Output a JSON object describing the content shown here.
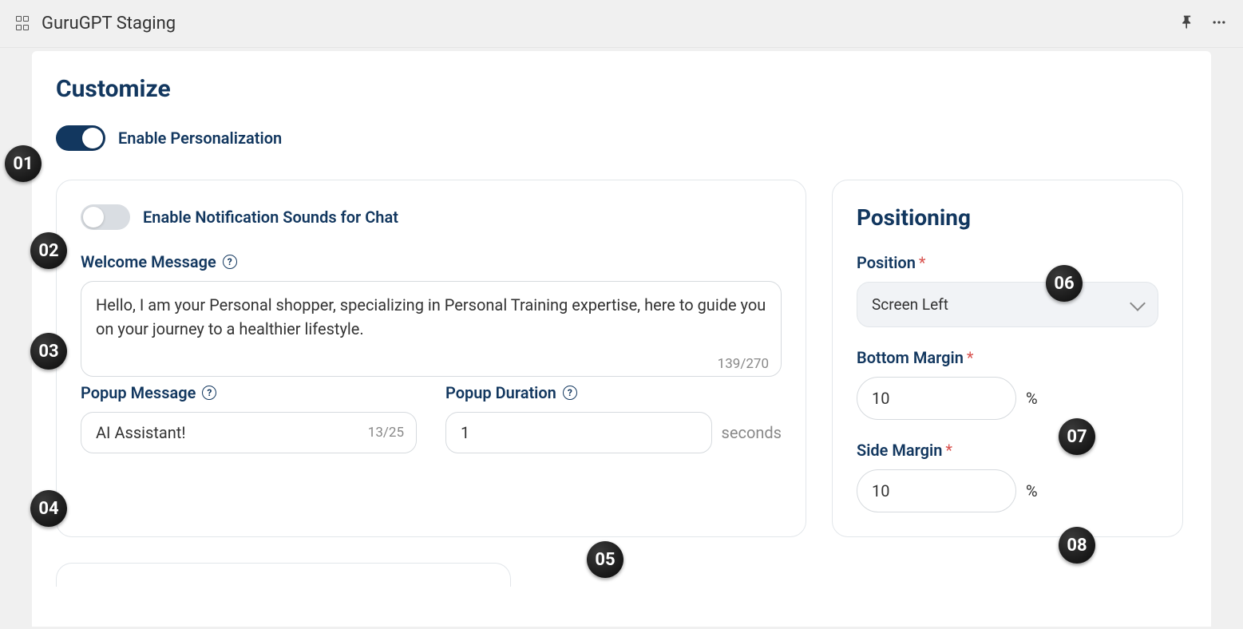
{
  "topbar": {
    "title": "GuruGPT Staging"
  },
  "page": {
    "heading": "Customize",
    "enable_personalization_label": "Enable Personalization",
    "enable_personalization_on": true
  },
  "main_card": {
    "enable_sounds_label": "Enable Notification Sounds for Chat",
    "enable_sounds_on": false,
    "welcome_label": "Welcome Message",
    "welcome_value": "Hello, I am your Personal shopper, specializing in Personal Training expertise, here to guide you on your journey to a healthier lifestyle.",
    "welcome_count": "139/270",
    "popup_msg_label": "Popup Message",
    "popup_msg_value": "AI Assistant!",
    "popup_msg_count": "13/25",
    "popup_dur_label": "Popup Duration",
    "popup_dur_value": "1",
    "popup_dur_suffix": "seconds"
  },
  "side_card": {
    "title": "Positioning",
    "position_label": "Position",
    "position_value": "Screen Left",
    "bottom_margin_label": "Bottom Margin",
    "bottom_margin_value": "10",
    "side_margin_label": "Side Margin",
    "side_margin_value": "10",
    "pct": "%"
  },
  "badges": {
    "b1": "01",
    "b2": "02",
    "b3": "03",
    "b4": "04",
    "b5": "05",
    "b6": "06",
    "b7": "07",
    "b8": "08"
  }
}
